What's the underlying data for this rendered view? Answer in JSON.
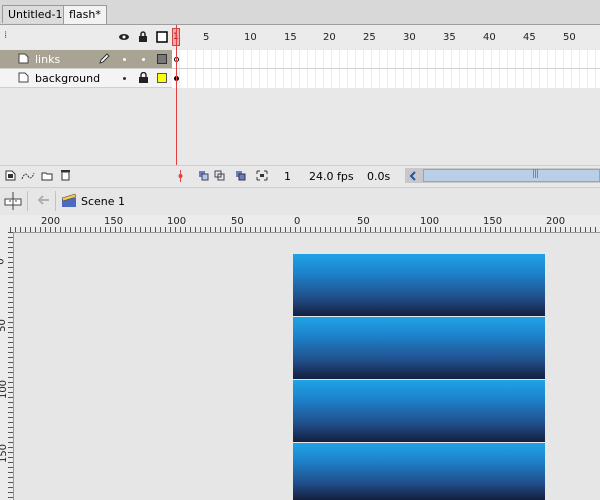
{
  "tabs": [
    {
      "label": "Untitled-1",
      "active": false
    },
    {
      "label": "flash*",
      "active": true
    }
  ],
  "timeline": {
    "frame_ticks": [
      "1",
      "5",
      "10",
      "15",
      "20",
      "25",
      "30",
      "35",
      "40",
      "45",
      "50"
    ],
    "layers": [
      {
        "name": "links",
        "selected": true
      },
      {
        "name": "background",
        "selected": false
      }
    ],
    "status": {
      "current_frame": "1",
      "fps": "24.0 fps",
      "elapsed": "0.0s"
    },
    "scroll_left_icon": "scroll-left-arrow-icon"
  },
  "edit_bar": {
    "scene_label": "Scene 1"
  },
  "rulers": {
    "h_labels": [
      "200",
      "150",
      "100",
      "50",
      "0",
      "50",
      "100",
      "150",
      "200"
    ],
    "v_labels": [
      "0",
      "50",
      "100",
      "150"
    ]
  },
  "colors": {
    "band_top": "#1fa3e7",
    "band_bottom": "#141f3e",
    "selected_layer": "#a9a394",
    "playhead": "#e04040"
  }
}
